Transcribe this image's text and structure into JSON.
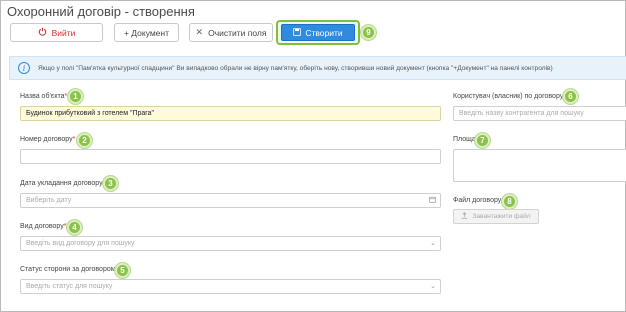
{
  "window": {
    "title": "Охоронний договір - створення"
  },
  "toolbar": {
    "exit_label": "Вийти",
    "document_label": "+ Документ",
    "clear_label": "Очистити поля",
    "create_label": "Створити",
    "create_marker": "9"
  },
  "info": {
    "text": "Якщо у полі \"Пам'ятка культурної спадщини\" Ви випадково обрали не вірну пам'ятку, оберіть нову, створивши новий документ (кнопка \"+Документ\" на панелі контролів)"
  },
  "form": {
    "object_name": {
      "label": "Назва об'єкта",
      "required": "*",
      "value": "Будинок прибутковий з готелем \"Прага\"",
      "marker": "1"
    },
    "contract_number": {
      "label": "Номер договору",
      "required": "*",
      "value": "",
      "marker": "2"
    },
    "contract_date": {
      "label": "Дата укладання договору",
      "required": "*",
      "placeholder": "Виберіть дату",
      "marker": "3"
    },
    "contract_type": {
      "label": "Вид договору",
      "required": "*",
      "placeholder": "Введіть вид договору для пошуку",
      "marker": "4"
    },
    "party_status": {
      "label": "Статус сторони за договором",
      "required": "*",
      "placeholder": "Введіть статус для пошуку",
      "marker": "5"
    },
    "user_owner": {
      "label": "Користувач (власник) по договору",
      "required": "*",
      "placeholder": "Введіть назву контрагента для пошуку",
      "marker": "6"
    },
    "area": {
      "label": "Площа",
      "marker": "7"
    },
    "contract_file": {
      "label": "Файл договору",
      "upload_label": "Завантажити файл",
      "marker": "8"
    }
  },
  "icons": {
    "exit": "power-icon",
    "clear": "close-icon",
    "create": "save-icon",
    "calendar": "calendar-icon",
    "dropdown": "chevron-down-icon",
    "info": "info-icon",
    "upload": "upload-icon"
  },
  "colors": {
    "accent": "#2f8be0",
    "marker": "#8bc34a",
    "required": "#d32f2f",
    "filled_input": "#fdfbd9"
  }
}
